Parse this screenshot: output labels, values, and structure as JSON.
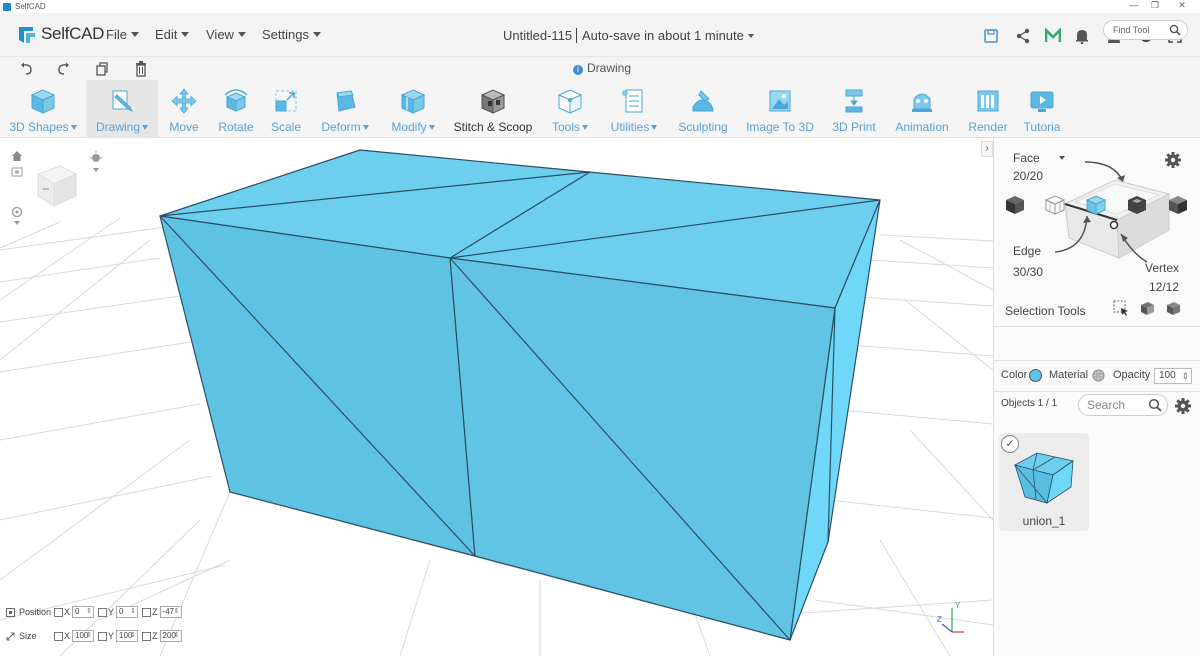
{
  "window": {
    "title": "SelfCAD",
    "controls": [
      "—",
      "❐",
      "✕"
    ]
  },
  "app": {
    "name": "SelfCAD"
  },
  "menu": [
    {
      "label": "File",
      "name": "menu-file"
    },
    {
      "label": "Edit",
      "name": "menu-edit"
    },
    {
      "label": "View",
      "name": "menu-view"
    },
    {
      "label": "Settings",
      "name": "menu-settings"
    }
  ],
  "document": {
    "title": "Untitled-115",
    "autosave": "Auto-save in about 1 minute"
  },
  "mode": {
    "label": "Drawing"
  },
  "toolbar": [
    {
      "label": "3D Shapes",
      "dropdown": true,
      "icon": "cube-icon"
    },
    {
      "label": "Drawing",
      "dropdown": true,
      "icon": "drawing-icon",
      "active": true
    },
    {
      "label": "Move",
      "icon": "move-icon"
    },
    {
      "label": "Rotate",
      "icon": "rotate-icon"
    },
    {
      "label": "Scale",
      "icon": "scale-icon"
    },
    {
      "label": "Deform",
      "dropdown": true,
      "icon": "deform-icon"
    },
    {
      "label": "Modify",
      "dropdown": true,
      "icon": "modify-icon"
    },
    {
      "label": "Stitch & Scoop",
      "icon": "stitch-scoop-icon",
      "dark": true
    },
    {
      "label": "Tools",
      "dropdown": true,
      "icon": "tools-icon"
    },
    {
      "label": "Utilities",
      "dropdown": true,
      "icon": "utilities-icon"
    },
    {
      "label": "Sculpting",
      "icon": "sculpting-icon"
    },
    {
      "label": "Image To 3D",
      "icon": "image-to-3d-icon"
    },
    {
      "label": "3D Print",
      "icon": "3d-print-icon"
    },
    {
      "label": "Animation",
      "icon": "animation-icon"
    },
    {
      "label": "Render",
      "icon": "render-icon"
    },
    {
      "label": "Tutoria",
      "icon": "tutorial-icon"
    }
  ],
  "find_tool": {
    "placeholder": "Find Tool"
  },
  "selection": {
    "face_label": "Face",
    "face_count": "20/20",
    "edge_label": "Edge",
    "edge_count": "30/30",
    "vertex_label": "Vertex",
    "vertex_count": "12/12",
    "tools_label": "Selection Tools"
  },
  "properties": {
    "color_label": "Color",
    "color": "#5bc4e8",
    "material_label": "Material",
    "opacity_label": "Opacity",
    "opacity_value": "100"
  },
  "objects": {
    "count_label": "Objects 1 / 1",
    "search_placeholder": "Search",
    "items": [
      {
        "name": "union_1",
        "selected": true
      }
    ]
  },
  "transform": {
    "position_label": "Position",
    "size_label": "Size",
    "position": {
      "x": "0",
      "y": "0",
      "z": "-47"
    },
    "size": {
      "x": "100",
      "y": "100",
      "z": "200"
    }
  },
  "colors": {
    "accent": "#5aa0d6",
    "model_fill": "#5ec5e6",
    "model_edge": "#2b4f66",
    "grid": "#d6d6d6"
  }
}
